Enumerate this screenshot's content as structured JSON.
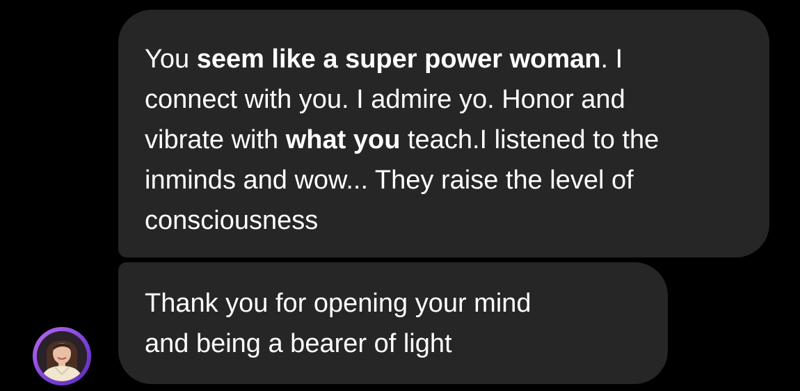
{
  "messages": [
    {
      "lines": [
        [
          "You ",
          "seem like a super power woman",
          ". I"
        ],
        [
          "connect with you. I admire yo. Honor and"
        ],
        [
          "vibrate with ",
          "what you",
          " teach.I listened to the"
        ],
        [
          "inminds and wow... They raise the level of"
        ],
        [
          "consciousness"
        ]
      ]
    },
    {
      "lines": [
        "Thank you for opening your mind",
        "and being a bearer of light"
      ]
    }
  ],
  "avatar": {
    "icon": "profile-photo",
    "ring_color": "#9b59e6"
  },
  "colors": {
    "background": "#000000",
    "bubble": "#262626",
    "text": "#ffffff"
  }
}
